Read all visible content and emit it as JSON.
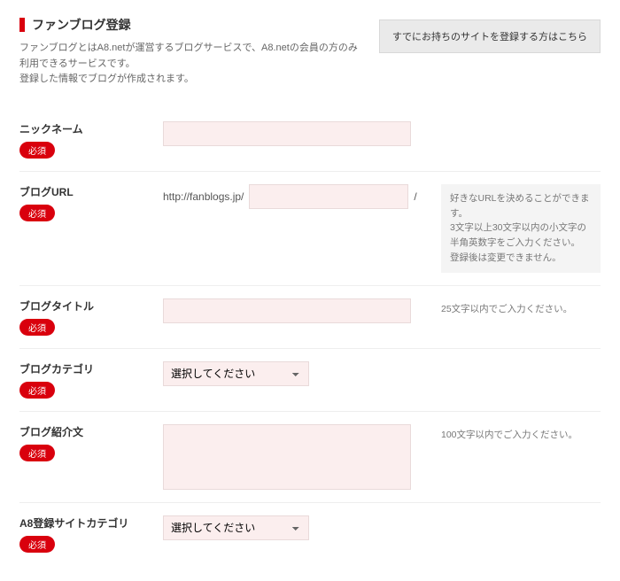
{
  "header": {
    "title": "ファンブログ登録",
    "subtitle_line1": "ファンブログとはA8.netが運営するブログサービスで、A8.netの会員の方のみ利用できるサービスです。",
    "subtitle_line2": "登録した情報でブログが作成されます。",
    "alt_button": "すでにお持ちのサイトを登録する方はこちら"
  },
  "badge": "必須",
  "fields": {
    "nickname": {
      "label": "ニックネーム"
    },
    "blog_url": {
      "label": "ブログURL",
      "prefix": "http://fanblogs.jp/",
      "suffix": "/",
      "hint": "好きなURLを決めることができます。\n3文字以上30文字以内の小文字の半角英数字をご入力ください。\n登録後は変更できません。"
    },
    "blog_title": {
      "label": "ブログタイトル",
      "hint": "25文字以内でご入力ください。"
    },
    "blog_category": {
      "label": "ブログカテゴリ",
      "placeholder": "選択してください"
    },
    "blog_intro": {
      "label": "ブログ紹介文",
      "hint": "100文字以内でご入力ください。"
    },
    "a8_category": {
      "label": "A8登録サイトカテゴリ",
      "placeholder": "選択してください"
    }
  }
}
